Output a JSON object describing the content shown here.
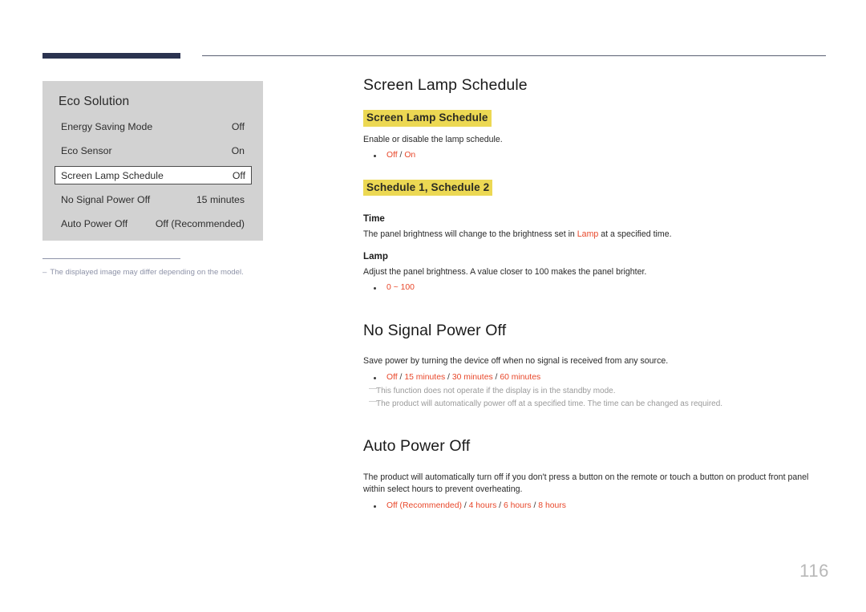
{
  "page": {
    "number": "116"
  },
  "osd": {
    "title": "Eco Solution",
    "rows": [
      {
        "label": "Energy Saving Mode",
        "value": "Off",
        "selected": false
      },
      {
        "label": "Eco Sensor",
        "value": "On",
        "selected": false
      },
      {
        "label": "Screen Lamp Schedule",
        "value": "Off",
        "selected": true
      },
      {
        "label": "No Signal Power Off",
        "value": "15 minutes",
        "selected": false
      },
      {
        "label": "Auto Power Off",
        "value": "Off (Recommended)",
        "selected": false
      }
    ]
  },
  "side_note": {
    "dash": "–",
    "text": "The displayed image may differ depending on the model."
  },
  "sections": {
    "screen_lamp_schedule": {
      "title": "Screen Lamp Schedule",
      "highlight_1": "Screen Lamp Schedule",
      "desc_1": "Enable or disable the lamp schedule.",
      "options_1": {
        "a": "Off",
        "sep": " / ",
        "b": "On"
      },
      "highlight_2": "Schedule 1, Schedule 2",
      "time_head": "Time",
      "time_desc_before": "The panel brightness will change to the brightness set in ",
      "time_desc_ref": "Lamp",
      "time_desc_after": " at a specified time.",
      "lamp_head": "Lamp",
      "lamp_desc": "Adjust the panel brightness. A value closer to 100 makes the panel brighter.",
      "lamp_range": "0 ~ 100"
    },
    "no_signal_power_off": {
      "title": "No Signal Power Off",
      "desc": "Save power by turning the device off when no signal is received from any source.",
      "options": [
        "Off",
        "15 minutes",
        "30 minutes",
        "60 minutes"
      ],
      "note_1": "This function does not operate if the display is in the standby mode.",
      "note_2": "The product will automatically power off at a specified time. The time can be changed as required.",
      "note_dash": "—"
    },
    "auto_power_off": {
      "title": "Auto Power Off",
      "desc": "The product will automatically turn off if you don't press a button on the remote or touch a button on product front panel within select hours to prevent overheating.",
      "options": [
        "Off (Recommended)",
        "4 hours",
        "6 hours",
        "8 hours"
      ]
    }
  },
  "colors": {
    "highlight": "#ecd853",
    "option_red": "#e8472a",
    "header_bar": "#2b3350",
    "panel_bg": "#d2d2d2"
  }
}
